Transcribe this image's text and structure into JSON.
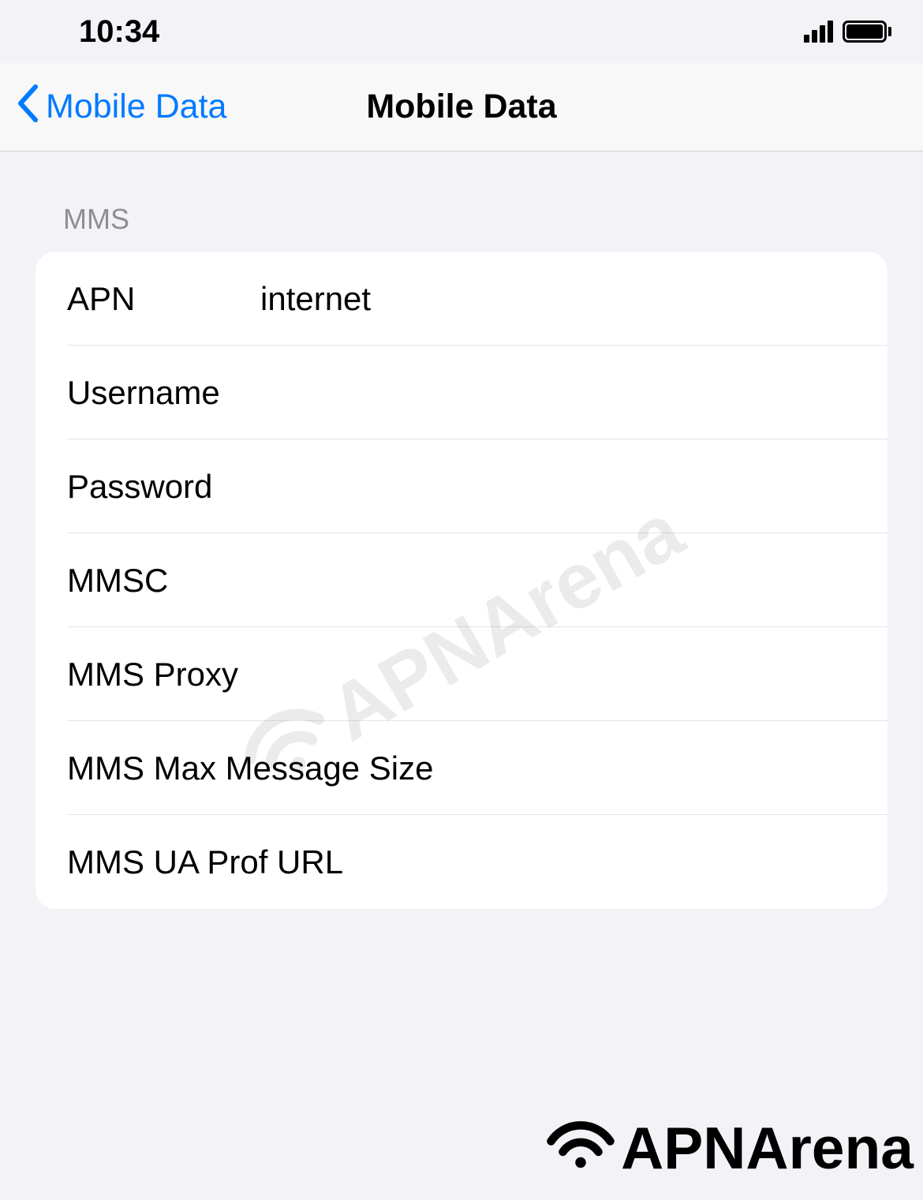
{
  "status_bar": {
    "time": "10:34"
  },
  "nav": {
    "back_label": "Mobile Data",
    "title": "Mobile Data"
  },
  "section_title": "MMS",
  "fields": {
    "apn": {
      "label": "APN",
      "value": "internet"
    },
    "username": {
      "label": "Username",
      "value": ""
    },
    "password": {
      "label": "Password",
      "value": ""
    },
    "mmsc": {
      "label": "MMSC",
      "value": ""
    },
    "mms_proxy": {
      "label": "MMS Proxy",
      "value": ""
    },
    "mms_max_size": {
      "label": "MMS Max Message Size",
      "value": ""
    },
    "mms_ua_prof": {
      "label": "MMS UA Prof URL",
      "value": ""
    }
  },
  "watermark": {
    "text": "APNArena"
  }
}
